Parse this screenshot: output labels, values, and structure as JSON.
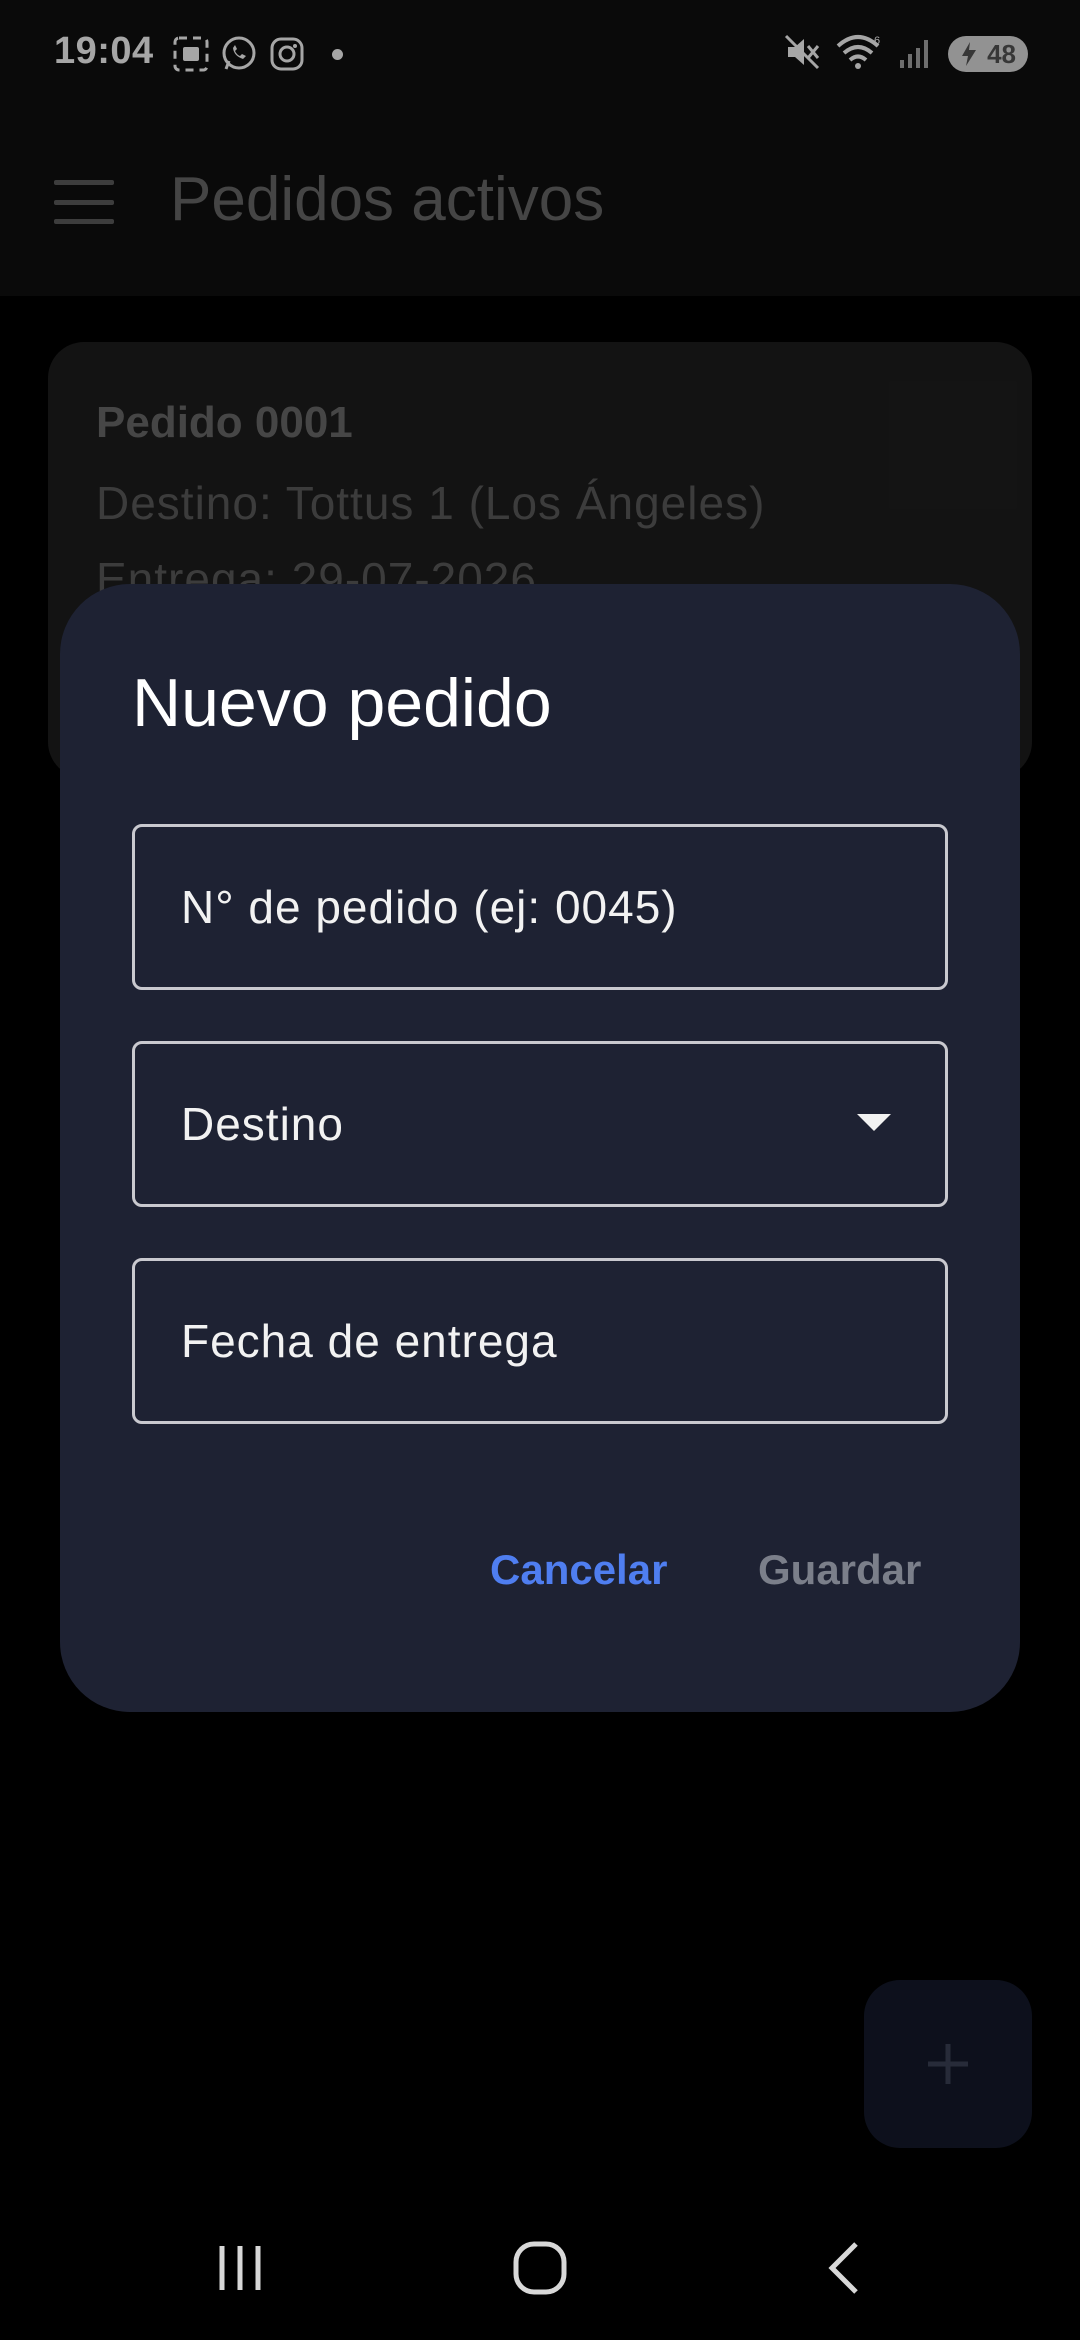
{
  "status_bar": {
    "time": "19:04",
    "battery_level": "48",
    "notification_icons": [
      "screen-recorder-icon",
      "whatsapp-icon",
      "instagram-icon",
      "dot-icon"
    ],
    "system_icons": [
      "mute-icon",
      "wifi-icon",
      "signal-icon",
      "battery-icon"
    ]
  },
  "app_bar": {
    "title": "Pedidos activos",
    "menu_icon": "hamburger-menu-icon"
  },
  "order_card": {
    "title": "Pedido 0001",
    "destination": "Destino: Tottus 1 (Los Ángeles)",
    "delivery": "Entrega: 29-07-2026"
  },
  "dialog": {
    "title": "Nuevo pedido",
    "order_number_label": "N° de pedido (ej: 0045)",
    "destination_label": "Destino",
    "date_label": "Fecha de entrega",
    "cancel_label": "Cancelar",
    "save_label": "Guardar"
  },
  "fab": {
    "icon": "plus-icon"
  },
  "nav_bar": {
    "icons": [
      "recent-apps-icon",
      "home-icon",
      "back-icon"
    ]
  },
  "colors": {
    "accent": "#4f7ef0",
    "dialog_bg": "#1e2233",
    "disabled_text": "#7b7f8a"
  }
}
